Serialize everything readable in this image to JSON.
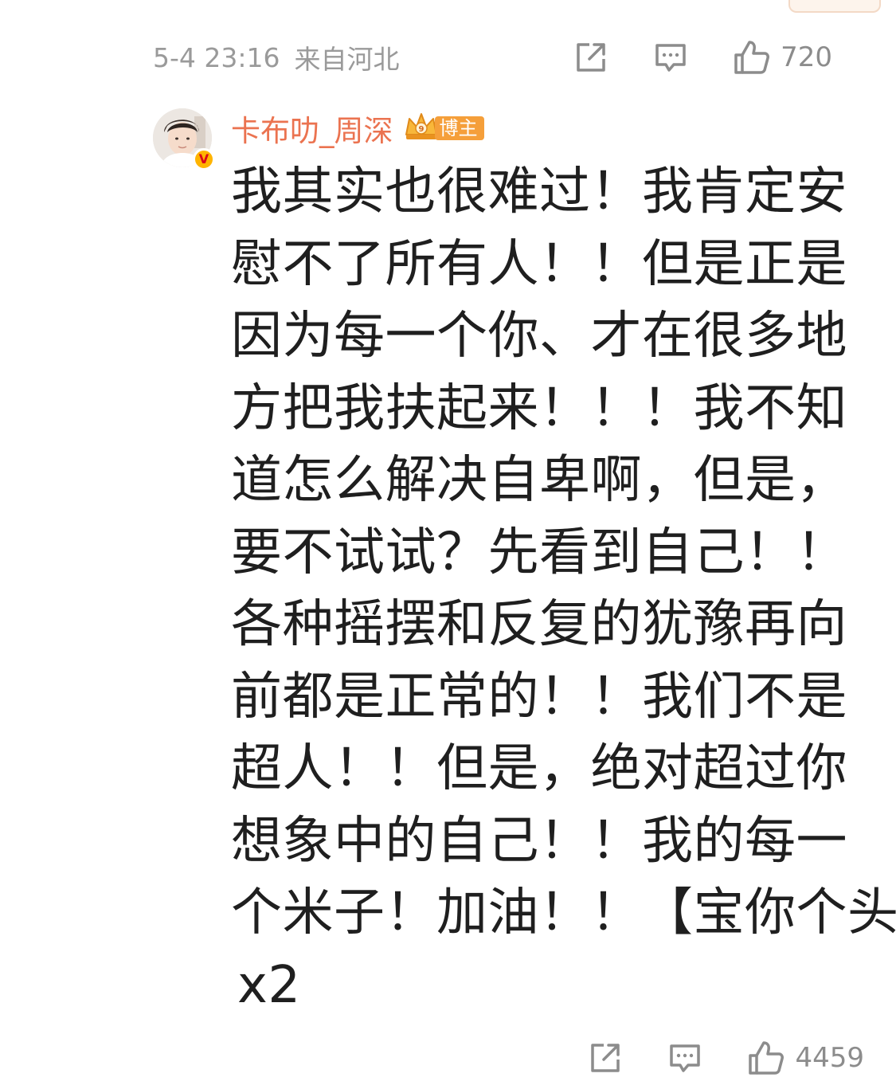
{
  "top_comment": {
    "timestamp": "5-4 23:16",
    "location": "来自河北",
    "like_count": "720"
  },
  "reply": {
    "username": "卡布叻_周深",
    "badge_label": "博主",
    "verified_mark": "V",
    "content_lines": [
      "我其实也很难过！我肯定安",
      "慰不了所有人！！但是正是",
      "因为每一个你、才在很多地",
      "方把我扶起来！！！我不知",
      "道怎么解决自卑啊，但是，",
      "要不试试？先看到自己！！",
      "各种摇摆和反复的犹豫再向",
      "前都是正常的！！我们不是",
      "超人！！但是，绝对超过你",
      "想象中的自己！！我的每一",
      "个米子！加油！！【宝你个头",
      "x2"
    ],
    "like_count": "4459"
  },
  "colors": {
    "username": "#eb7350",
    "meta_text": "#9a9a9a",
    "icon_stroke": "#8c8c8c",
    "badge_bg": "#f59f3a"
  },
  "icons": {
    "share": "share-icon",
    "comment": "comment-icon",
    "like": "thumbs-up-icon",
    "crown": "crown-icon"
  }
}
